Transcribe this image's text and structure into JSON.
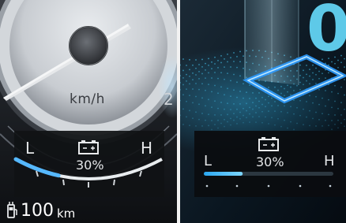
{
  "speedometer": {
    "unit": "km/h",
    "partial_digit": "2"
  },
  "battery_gauge_left": {
    "low_label": "L",
    "high_label": "H",
    "percent_label": "30%",
    "level_fraction": 0.3,
    "icon": "battery-icon"
  },
  "range": {
    "icon": "fuel-pump-icon",
    "value": "100",
    "unit": "km"
  },
  "battery_gauge_right": {
    "low_label": "L",
    "high_label": "H",
    "percent_label": "30%",
    "level_fraction": 0.3,
    "icon": "battery-icon"
  },
  "gear_display": {
    "value": "0"
  },
  "colors": {
    "accent": "#4fc3f7",
    "accent_dark": "#1e88e5",
    "background": "#0c1118"
  }
}
